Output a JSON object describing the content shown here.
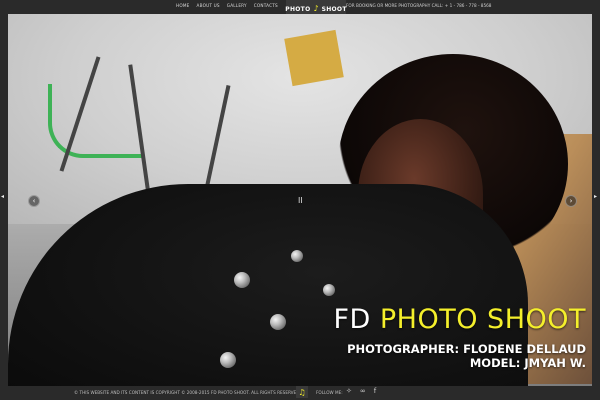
{
  "nav": {
    "items": [
      {
        "label": "HOME"
      },
      {
        "label": "ABOUT US"
      },
      {
        "label": "GALLERY"
      },
      {
        "label": "CONTACTS"
      }
    ],
    "logo": {
      "left": "PHOTO",
      "right": "SHOOT"
    },
    "booking_text": "FOR BOOKING OR MORE PHOTOGRAPHY CALL: + 1 - 786 - 778 - 8568"
  },
  "slider": {
    "prev_symbol": "‹",
    "next_symbol": "›",
    "pause_symbol": "II"
  },
  "hero": {
    "title_prefix": "FD ",
    "title_highlight": "PHOTO SHOOT",
    "photographer_line": "PHOTOGRAPHER: FLODENE DELLAUD",
    "model_line": "MODEL: JMYAH W."
  },
  "footer": {
    "copyright": "© THIS WEBSITE AND ITS CONTENT IS COPYRIGHT © 2008-2015 FD PHOTO SHOOT. ALL RIGHTS RESERVED.",
    "music_icon_symbol": "♫",
    "follow_label": "FOLLOW ME:",
    "social": [
      {
        "name": "twitter-icon",
        "glyph": "✧"
      },
      {
        "name": "link-icon",
        "glyph": "∞"
      },
      {
        "name": "facebook-icon",
        "glyph": "f"
      }
    ]
  },
  "colors": {
    "accent_yellow": "#f4ef2b",
    "bar_bg": "#2a2a2a",
    "tab_bg": "#3a3a3a"
  }
}
